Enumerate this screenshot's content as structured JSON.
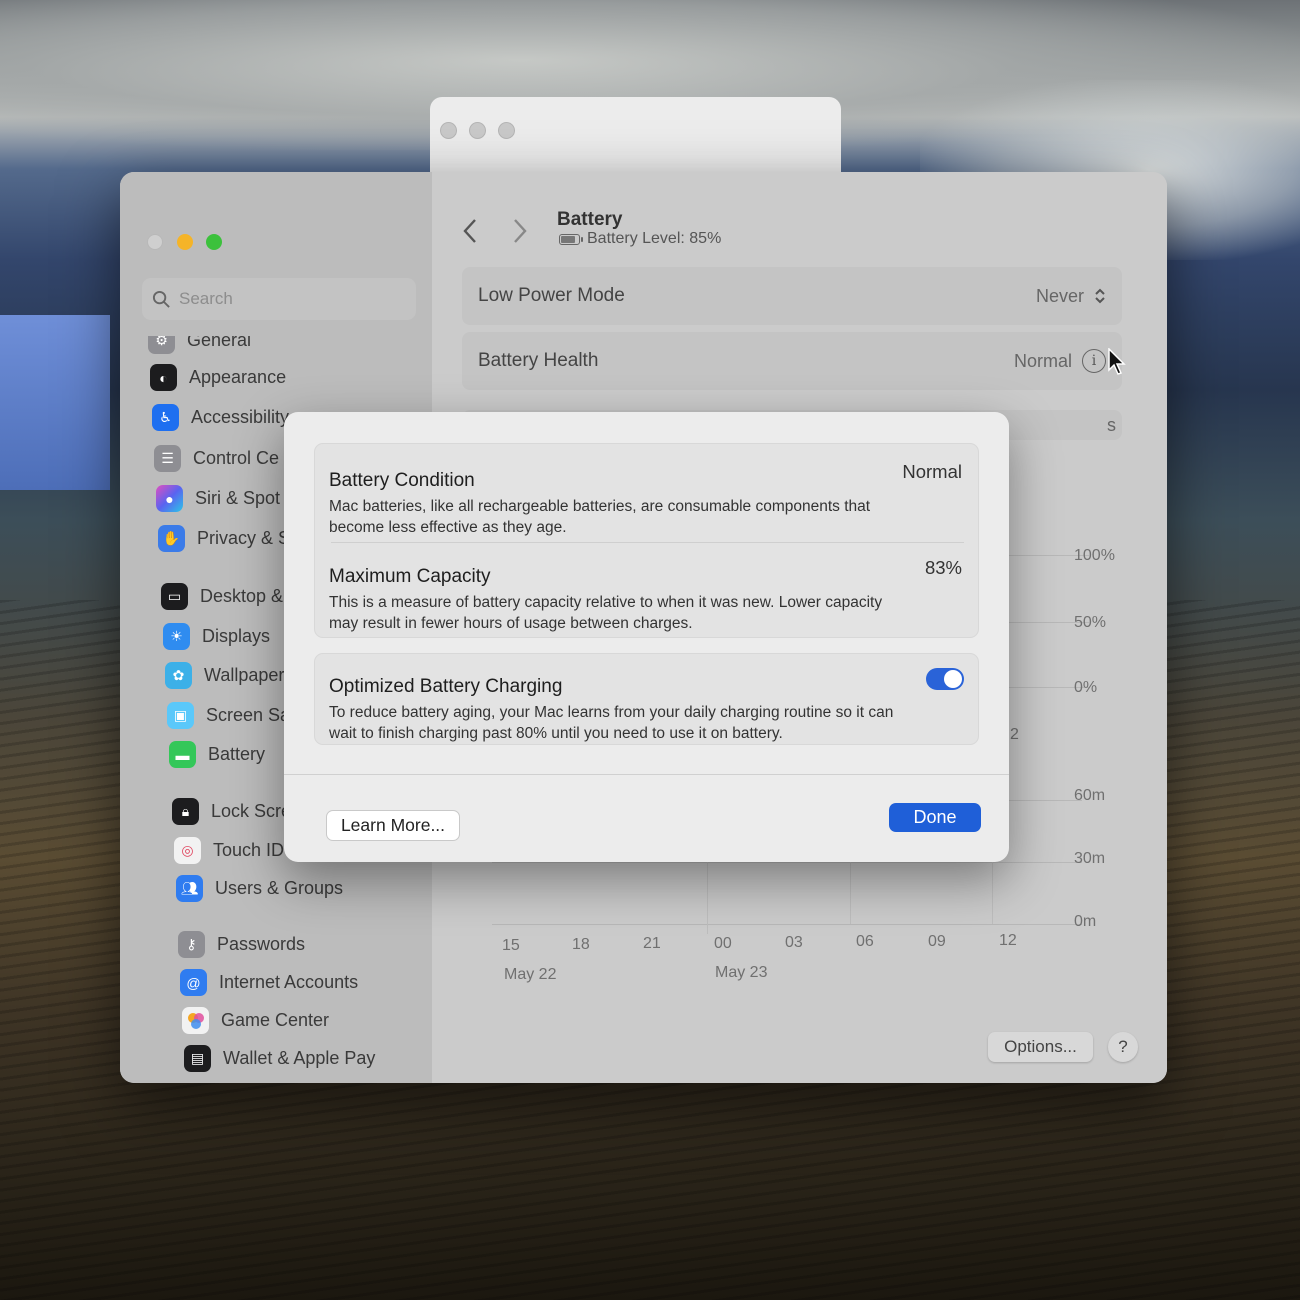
{
  "colors": {
    "accent": "#1f5fd8",
    "toggle_on": "#2a63d8",
    "close": "#cfcfcf",
    "minimize": "#f5b428",
    "zoom": "#3cc13c"
  },
  "sidebar": {
    "search_placeholder": "Search",
    "items": [
      {
        "label": "General",
        "icon": "gear-icon",
        "color": "#8e8e93"
      },
      {
        "label": "Appearance",
        "icon": "appearance-icon",
        "color": "#1c1c1e"
      },
      {
        "label": "Accessibility",
        "icon": "accessibility-icon",
        "color": "#1e6ff0"
      },
      {
        "label": "Control Ce",
        "icon": "control-center-icon",
        "color": "#8e8e93"
      },
      {
        "label": "Siri & Spot",
        "icon": "siri-icon",
        "color": "#8a52d6"
      },
      {
        "label": "Privacy & S",
        "icon": "hand-icon",
        "color": "#3b7be8"
      },
      {
        "label": "Desktop &",
        "icon": "desktop-icon",
        "color": "#1c1c1e"
      },
      {
        "label": "Displays",
        "icon": "sun-icon",
        "color": "#2f8cf0"
      },
      {
        "label": "Wallpaper",
        "icon": "flower-icon",
        "color": "#3cb0e8"
      },
      {
        "label": "Screen Sav",
        "icon": "screensaver-icon",
        "color": "#5ac8fa"
      },
      {
        "label": "Battery",
        "icon": "battery-icon",
        "color": "#34c759"
      },
      {
        "label": "Lock Scree",
        "icon": "lock-icon",
        "color": "#1c1c1e"
      },
      {
        "label": "Touch ID &",
        "icon": "fingerprint-icon",
        "color": "#f2f2f2"
      },
      {
        "label": "Users & Groups",
        "icon": "users-icon",
        "color": "#2f7cf0"
      },
      {
        "label": "Passwords",
        "icon": "key-icon",
        "color": "#8e8e93"
      },
      {
        "label": "Internet Accounts",
        "icon": "at-icon",
        "color": "#2f7cf0"
      },
      {
        "label": "Game Center",
        "icon": "game-center-icon",
        "color": "#f2f2f2"
      },
      {
        "label": "Wallet & Apple Pay",
        "icon": "wallet-icon",
        "color": "#1c1c1e"
      }
    ]
  },
  "header": {
    "title": "Battery",
    "battery_level_text": "Battery Level: 85%",
    "battery_level_value": 0.85
  },
  "rows": {
    "low_power_label": "Low Power Mode",
    "low_power_value": "Never",
    "health_label": "Battery Health",
    "health_value": "Normal",
    "tab_fragment": "s"
  },
  "chart": {
    "level_ticks": [
      "100%",
      "50%",
      "0%"
    ],
    "usage_ticks": [
      "60m",
      "30m",
      "0m"
    ],
    "x_ticks": [
      "15",
      "18",
      "21",
      "00",
      "03",
      "06",
      "09",
      "12"
    ],
    "date_labels": [
      "May 22",
      "May 23"
    ],
    "fragment": "2"
  },
  "footer": {
    "options_label": "Options...",
    "help_label": "?"
  },
  "sheet": {
    "condition_title": "Battery Condition",
    "condition_value": "Normal",
    "condition_desc": "Mac batteries, like all rechargeable batteries, are consumable components that become less effective as they age.",
    "capacity_title": "Maximum Capacity",
    "capacity_value": "83%",
    "capacity_desc": "This is a measure of battery capacity relative to when it was new. Lower capacity may result in fewer hours of usage between charges.",
    "optimized_title": "Optimized Battery Charging",
    "optimized_desc": "To reduce battery aging, your Mac learns from your daily charging routine so it can wait to finish charging past 80% until you need to use it on battery.",
    "optimized_on": true,
    "learn_more_label": "Learn More...",
    "done_label": "Done"
  }
}
